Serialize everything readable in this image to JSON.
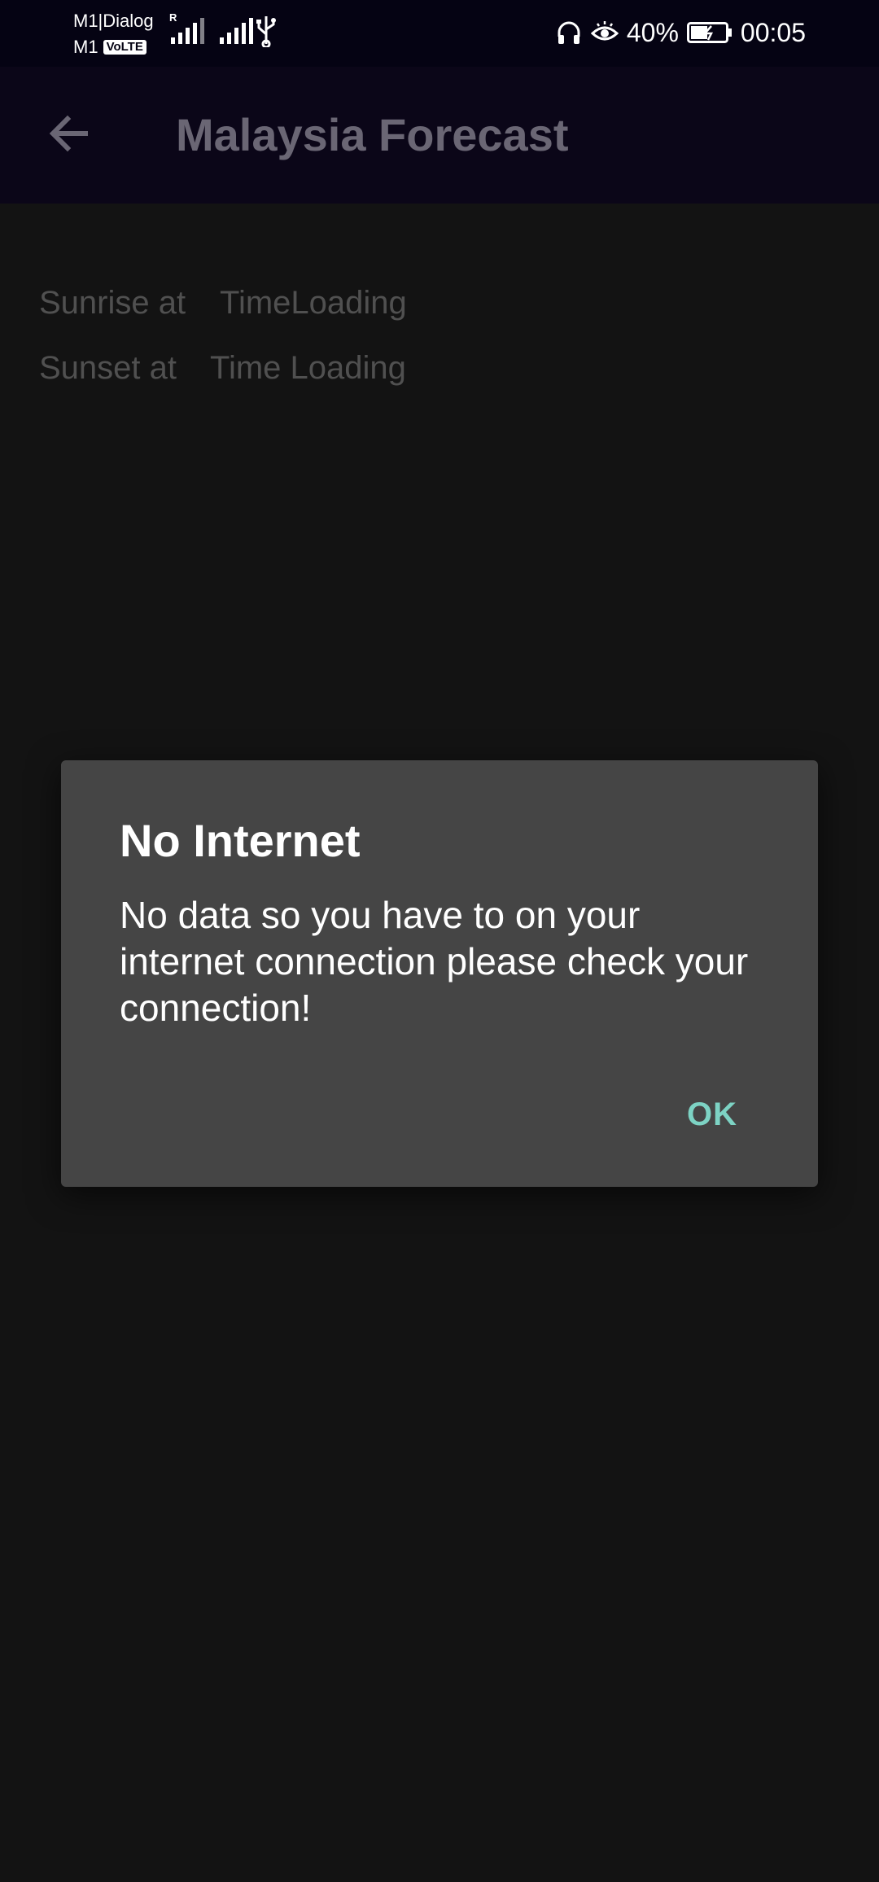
{
  "status_bar": {
    "carrier_1": "M1|Dialog",
    "carrier_2": "M1",
    "volte_badge": "VoLTE",
    "roaming_flag": "R",
    "battery_percent": "40%",
    "time": "00:05",
    "icons": [
      "signal-icon",
      "signal-icon",
      "usb-icon",
      "headphones-icon",
      "eye-comfort-icon",
      "battery-charging-icon"
    ]
  },
  "app_bar": {
    "title": "Malaysia Forecast",
    "back_icon": "arrow-back-icon",
    "background_color": "#0b0618"
  },
  "content": {
    "sunrise_label": "Sunrise at",
    "sunrise_value": "TimeLoading",
    "sunset_label": "Sunset at",
    "sunset_value": "Time Loading"
  },
  "dialog": {
    "title": "No Internet",
    "message": "No data so you have to on your internet connection please check your connection!",
    "ok_label": "OK",
    "accent_color": "#7dd3c4"
  }
}
